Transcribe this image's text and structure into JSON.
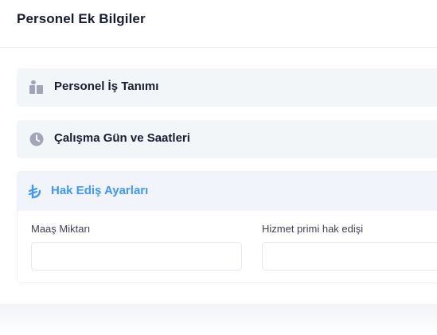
{
  "card": {
    "title": "Personel Ek Bilgiler"
  },
  "sections": [
    {
      "label": "Personel İş Tanımı",
      "icon": "book-icon",
      "expanded": false
    },
    {
      "label": "Çalışma Gün ve Saatleri",
      "icon": "clock-icon",
      "expanded": false
    },
    {
      "label": "Hak Ediş Ayarları",
      "icon": "lira-icon",
      "expanded": true
    }
  ],
  "form": {
    "maas_label": "Maaş Miktarı",
    "maas_value": "",
    "hizmet_label": "Hizmet primi hak edişi",
    "hizmet_value": ""
  },
  "colors": {
    "accent": "#3e97ff",
    "icon_gray": "#a1a5b7",
    "section_bg": "#f3f6f9"
  }
}
